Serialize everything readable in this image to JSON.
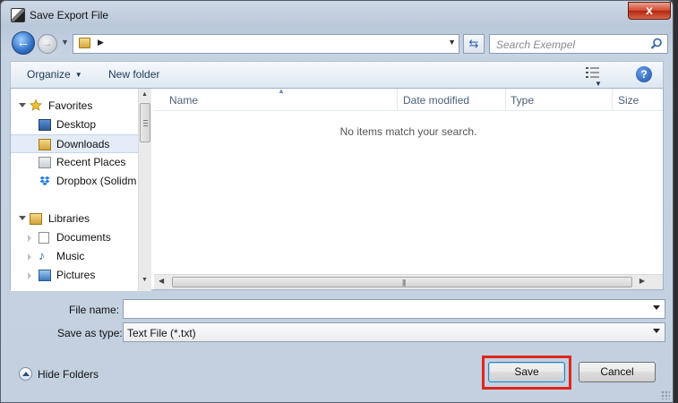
{
  "window": {
    "title": "Save Export File",
    "close_label": "x"
  },
  "navbar": {
    "back_label": "←",
    "forward_label": "→",
    "search_placeholder": "Search Exempel"
  },
  "toolbar": {
    "organize": "Organize",
    "new_folder": "New folder",
    "help": "?"
  },
  "nav_pane": {
    "favorites": "Favorites",
    "items": [
      "Desktop",
      "Downloads",
      "Recent Places",
      "Dropbox (Solidm"
    ],
    "libraries": "Libraries",
    "library_items": [
      "Documents",
      "Music",
      "Pictures"
    ]
  },
  "list": {
    "columns": [
      "Name",
      "Date modified",
      "Type",
      "Size"
    ],
    "empty_message": "No items match your search."
  },
  "fields": {
    "file_name_label": "File name:",
    "file_name_value": "",
    "save_type_label": "Save as type:",
    "save_type_value": "Text File (*.txt)"
  },
  "footer": {
    "hide_folders": "Hide Folders",
    "save": "Save",
    "cancel": "Cancel"
  },
  "colors": {
    "highlight": "#e1251b",
    "accent": "#2f6fc4"
  }
}
